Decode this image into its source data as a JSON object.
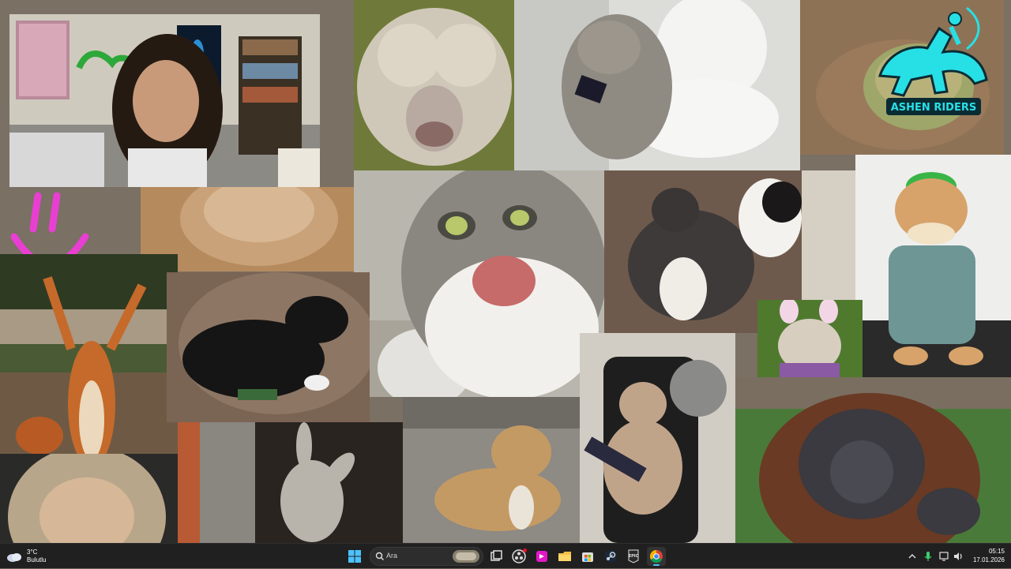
{
  "desktop": {
    "collage_logo": {
      "text": "ASHEN RIDERS"
    },
    "tiles": [
      {
        "name": "streamer-webcam"
      },
      {
        "name": "fluffy-sheep"
      },
      {
        "name": "cat-on-toilet-phone"
      },
      {
        "name": "frog-in-sand"
      },
      {
        "name": "blurry-cat-floor"
      },
      {
        "name": "screaming-cat"
      },
      {
        "name": "dogs-fighting"
      },
      {
        "name": "cat-in-green-hat"
      },
      {
        "name": "squirrel-arms-up"
      },
      {
        "name": "black-dog-controller"
      },
      {
        "name": "bulldog-bunny-ears"
      },
      {
        "name": "monkey-squinting"
      },
      {
        "name": "donkey-stall"
      },
      {
        "name": "dog-with-bread"
      },
      {
        "name": "cat-gaming-chair"
      },
      {
        "name": "orangutan"
      }
    ]
  },
  "taskbar": {
    "weather": {
      "temperature": "3°C",
      "condition": "Bulutlu"
    },
    "search": {
      "placeholder": "Ara"
    },
    "apps": [
      "start-icon",
      "search",
      "widget-pill-icon",
      "task-view-icon",
      "obs-icon",
      "davinci-icon",
      "file-explorer-icon",
      "store-icon",
      "steam-icon",
      "epic-games-icon",
      "chrome-icon"
    ],
    "tray": {
      "chevron": "chevron-up-icon"
    },
    "clock": {
      "time": "05:15",
      "date": "17.01.2026"
    }
  },
  "colors": {
    "taskbar_bg": "#202020",
    "logo_cyan": "#27e0e6",
    "smiley_pink": "#e83fd2"
  }
}
